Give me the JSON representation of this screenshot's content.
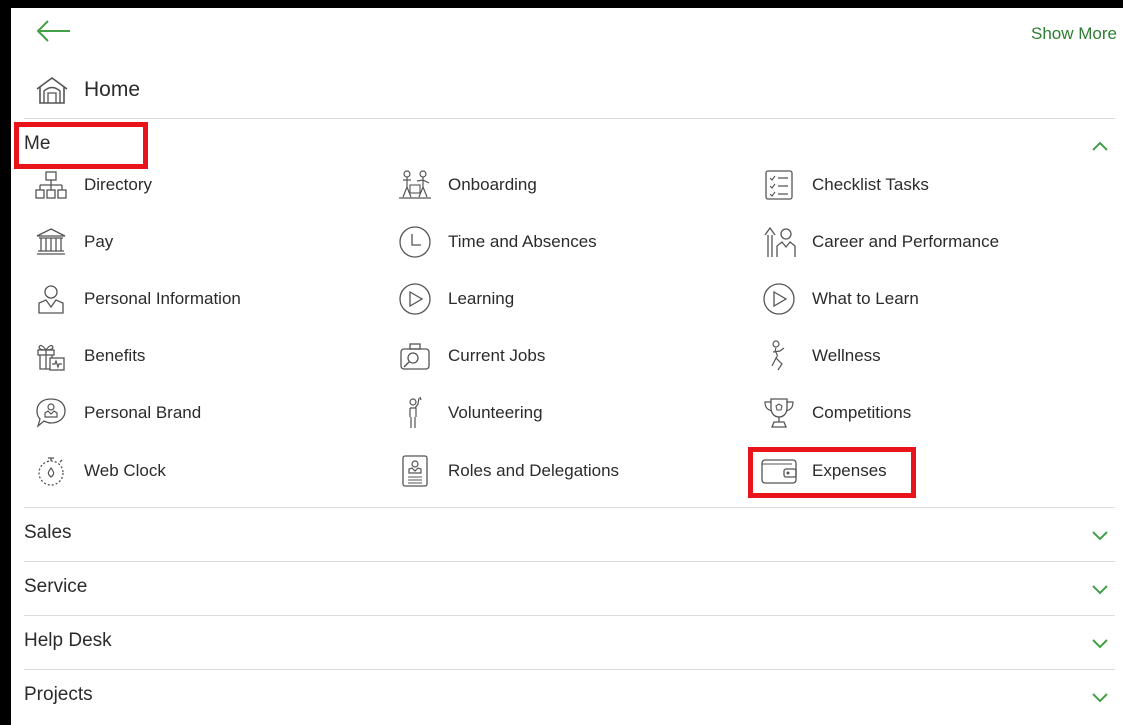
{
  "header": {
    "show_more_label": "Show More",
    "back_icon": "arrow-left-icon"
  },
  "home": {
    "label": "Home",
    "icon": "home-icon"
  },
  "me": {
    "title": "Me",
    "items": [
      {
        "label": "Directory",
        "icon": "org-chart-icon"
      },
      {
        "label": "Onboarding",
        "icon": "onboarding-icon"
      },
      {
        "label": "Checklist Tasks",
        "icon": "checklist-icon"
      },
      {
        "label": "Pay",
        "icon": "bank-icon"
      },
      {
        "label": "Time and Absences",
        "icon": "clock-icon"
      },
      {
        "label": "Career and Performance",
        "icon": "career-icon"
      },
      {
        "label": "Personal Information",
        "icon": "person-icon"
      },
      {
        "label": "Learning",
        "icon": "play-circle-icon"
      },
      {
        "label": "What to Learn",
        "icon": "play-circle-icon"
      },
      {
        "label": "Benefits",
        "icon": "gift-icon"
      },
      {
        "label": "Current Jobs",
        "icon": "jobs-icon"
      },
      {
        "label": "Wellness",
        "icon": "wellness-icon"
      },
      {
        "label": "Personal Brand",
        "icon": "chat-person-icon"
      },
      {
        "label": "Volunteering",
        "icon": "volunteer-icon"
      },
      {
        "label": "Competitions",
        "icon": "trophy-icon"
      },
      {
        "label": "Web Clock",
        "icon": "stopwatch-icon"
      },
      {
        "label": "Roles and Delegations",
        "icon": "id-badge-icon"
      },
      {
        "label": "Expenses",
        "icon": "wallet-icon"
      }
    ]
  },
  "sections": [
    {
      "title": "Sales",
      "expanded": false
    },
    {
      "title": "Service",
      "expanded": false
    },
    {
      "title": "Help Desk",
      "expanded": false
    },
    {
      "title": "Projects",
      "expanded": false
    }
  ],
  "colors": {
    "accent": "#43a047",
    "highlight": "#e8141a",
    "text": "#2b2b2b",
    "divider": "#dcdcdc"
  }
}
